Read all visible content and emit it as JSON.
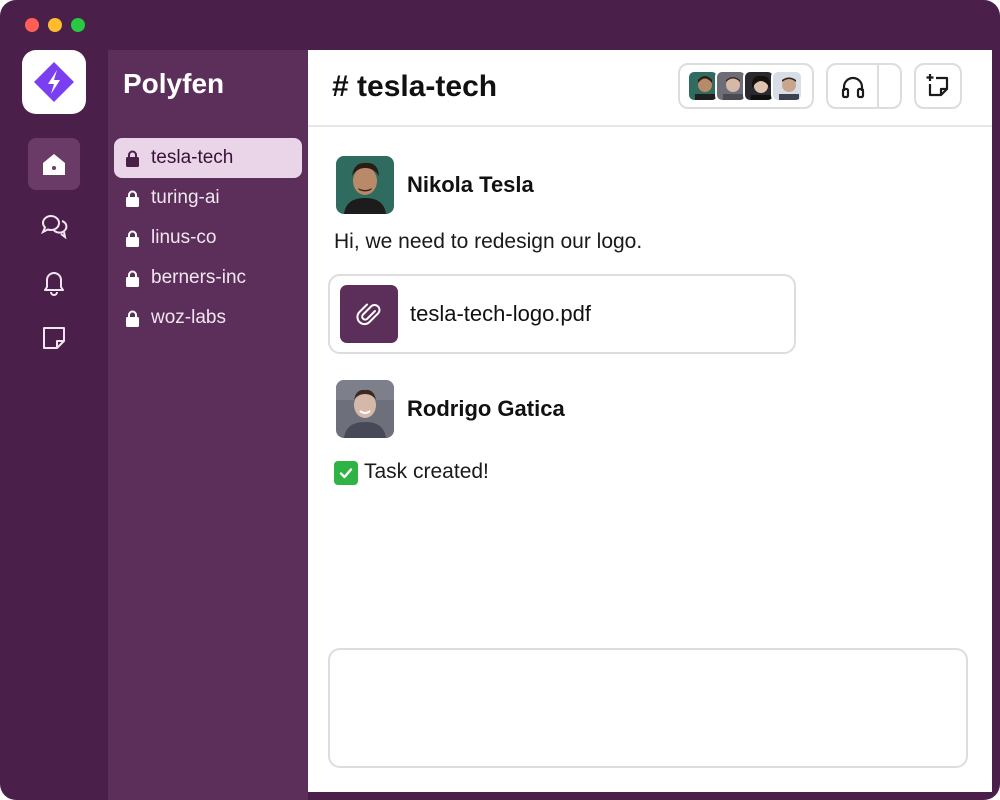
{
  "workspace": {
    "name": "Polyfen"
  },
  "rail": {
    "items": [
      {
        "icon": "home-icon",
        "active": true
      },
      {
        "icon": "chat-bubbles-icon",
        "active": false
      },
      {
        "icon": "bell-icon",
        "active": false
      },
      {
        "icon": "note-icon",
        "active": false
      }
    ]
  },
  "channels": [
    {
      "label": "tesla-tech",
      "active": true
    },
    {
      "label": "turing-ai",
      "active": false
    },
    {
      "label": "linus-co",
      "active": false
    },
    {
      "label": "berners-inc",
      "active": false
    },
    {
      "label": "woz-labs",
      "active": false
    }
  ],
  "header": {
    "title": "# tesla-tech"
  },
  "messages": [
    {
      "author": "Nikola Tesla",
      "text": "Hi, we need to redesign our logo.",
      "attachment": {
        "name": "tesla-tech-logo.pdf",
        "icon": "paperclip-icon"
      }
    },
    {
      "author": "Rodrigo Gatica",
      "text": "Task created!",
      "emoji": "check-mark-icon"
    }
  ],
  "composer": {
    "value": "",
    "placeholder": ""
  },
  "colors": {
    "window": "#4a1f4a",
    "sidebar": "#5c2e5a",
    "active_channel": "#e9d4e8",
    "accent": "#7b3ff2",
    "check": "#2fb344"
  }
}
